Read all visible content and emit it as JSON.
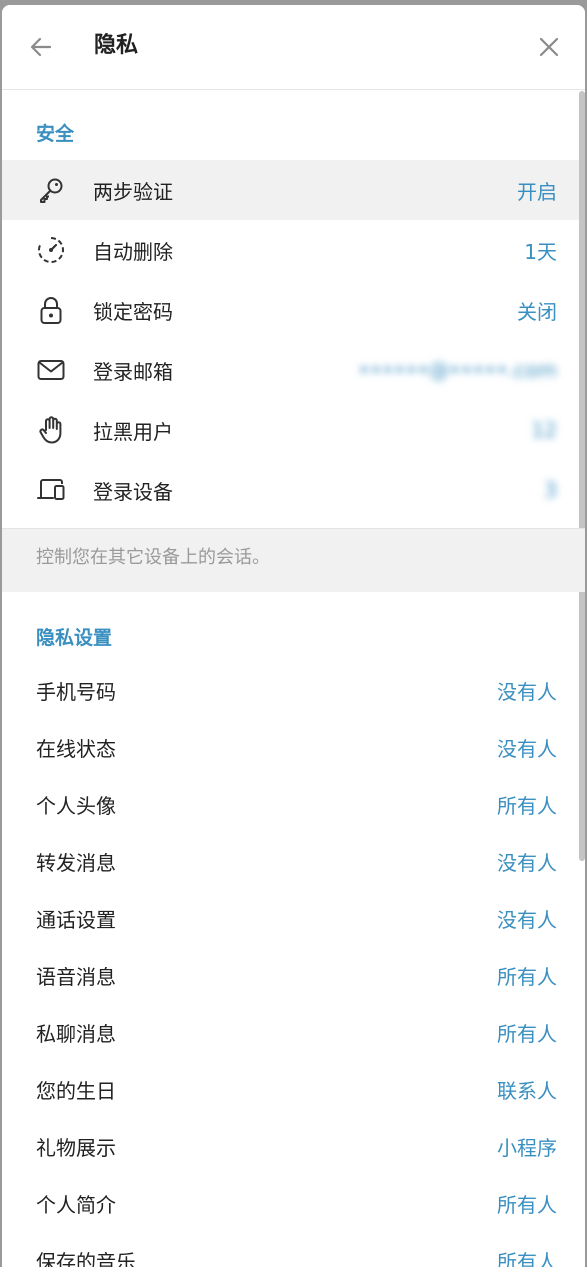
{
  "header": {
    "title": "隐私"
  },
  "security": {
    "title": "安全",
    "items": [
      {
        "label": "两步验证",
        "value": "开启",
        "icon": "key-icon"
      },
      {
        "label": "自动删除",
        "value": "1天",
        "icon": "timer-icon"
      },
      {
        "label": "锁定密码",
        "value": "关闭",
        "icon": "lock-icon"
      },
      {
        "label": "登录邮箱",
        "value": "••••••@•••••.com",
        "icon": "mail-icon"
      },
      {
        "label": "拉黑用户",
        "value": "12",
        "icon": "hand-icon"
      },
      {
        "label": "登录设备",
        "value": "3",
        "icon": "devices-icon"
      }
    ],
    "note": "控制您在其它设备上的会话。"
  },
  "privacy": {
    "title": "隐私设置",
    "items": [
      {
        "label": "手机号码",
        "value": "没有人"
      },
      {
        "label": "在线状态",
        "value": "没有人"
      },
      {
        "label": "个人头像",
        "value": "所有人"
      },
      {
        "label": "转发消息",
        "value": "没有人"
      },
      {
        "label": "通话设置",
        "value": "没有人"
      },
      {
        "label": "语音消息",
        "value": "所有人"
      },
      {
        "label": "私聊消息",
        "value": "所有人"
      },
      {
        "label": "您的生日",
        "value": "联系人"
      },
      {
        "label": "礼物展示",
        "value": "小程序"
      },
      {
        "label": "个人简介",
        "value": "所有人"
      },
      {
        "label": "保存的音乐",
        "value": "所有人"
      }
    ]
  },
  "colors": {
    "accent": "#3a8fc1",
    "text": "#222222",
    "muted": "#9a9a9a",
    "band": "#f1f1f1"
  }
}
